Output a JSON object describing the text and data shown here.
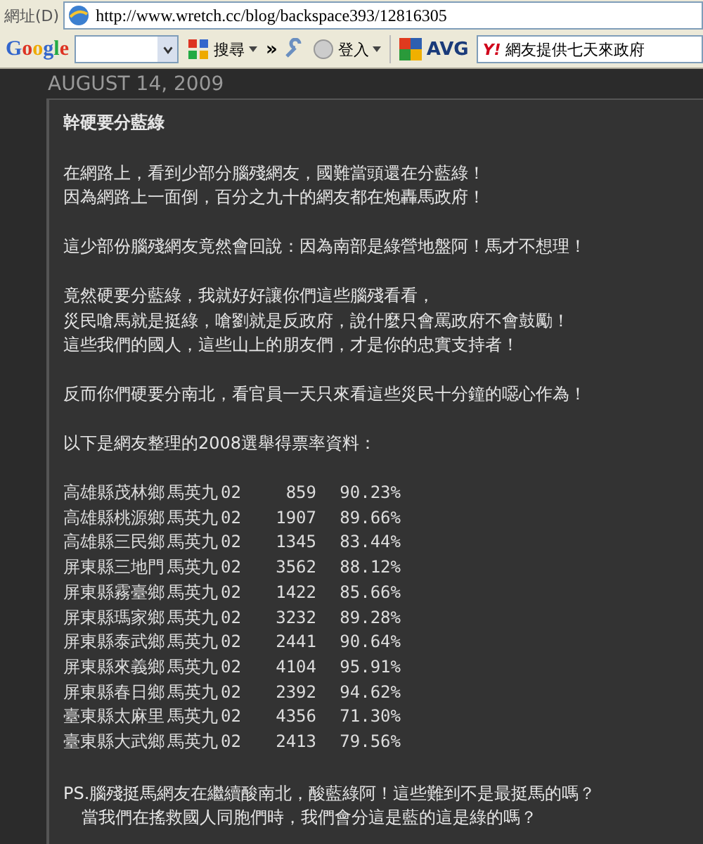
{
  "address_bar": {
    "label": "網址(D)",
    "url": "http://www.wretch.cc/blog/backspace393/12816305"
  },
  "toolbar": {
    "logo": "Google",
    "search_button": "搜尋",
    "more": "»",
    "sign_in": "登入",
    "avg": "AVG",
    "yahoo_logo": "Y!",
    "yahoo_field": "網友提供七天來政府"
  },
  "post": {
    "date": "AUGUST 14, 2009",
    "title": "幹硬要分藍綠",
    "paragraphs": [
      {
        "lines": [
          "在網路上，看到少部分腦殘網友，國難當頭還在分藍綠！",
          "因為網路上一面倒，百分之九十的網友都在炮轟馬政府！"
        ]
      },
      {
        "lines": [
          "這少部份腦殘網友竟然會回說：因為南部是綠營地盤阿！馬才不想理！"
        ]
      },
      {
        "lines": [
          "竟然硬要分藍綠，我就好好讓你們這些腦殘看看，",
          "災民嗆馬就是挺綠，嗆劉就是反政府，說什麼只會罵政府不會鼓勵！",
          "這些我們的國人，這些山上的朋友們，才是你的忠實支持者！"
        ]
      },
      {
        "lines": [
          "反而你們硬要分南北，看官員一天只來看這些災民十分鐘的噁心作為！"
        ]
      },
      {
        "lines": [
          "以下是網友整理的2008選舉得票率資料："
        ]
      }
    ],
    "table": {
      "rows": [
        {
          "place": "高雄縣茂林鄉",
          "candidate": "馬英九",
          "code": "02",
          "votes": "859",
          "percent": "90.23%"
        },
        {
          "place": "高雄縣桃源鄉",
          "candidate": "馬英九",
          "code": "02",
          "votes": "1907",
          "percent": "89.66%"
        },
        {
          "place": "高雄縣三民鄉",
          "candidate": "馬英九",
          "code": "02",
          "votes": "1345",
          "percent": "83.44%"
        },
        {
          "place": "屏東縣三地門",
          "candidate": "馬英九",
          "code": "02",
          "votes": "3562",
          "percent": "88.12%"
        },
        {
          "place": "屏東縣霧臺鄉",
          "candidate": "馬英九",
          "code": "02",
          "votes": "1422",
          "percent": "85.66%"
        },
        {
          "place": "屏東縣瑪家鄉",
          "candidate": "馬英九",
          "code": "02",
          "votes": "3232",
          "percent": "89.28%"
        },
        {
          "place": "屏東縣泰武鄉",
          "candidate": "馬英九",
          "code": "02",
          "votes": "2441",
          "percent": "90.64%"
        },
        {
          "place": "屏東縣來義鄉",
          "candidate": "馬英九",
          "code": "02",
          "votes": "4104",
          "percent": "95.91%"
        },
        {
          "place": "屏東縣春日鄉",
          "candidate": "馬英九",
          "code": "02",
          "votes": "2392",
          "percent": "94.62%"
        },
        {
          "place": "臺東縣太麻里",
          "candidate": "馬英九",
          "code": "02",
          "votes": "4356",
          "percent": "71.30%"
        },
        {
          "place": "臺東縣大武鄉",
          "candidate": "馬英九",
          "code": "02",
          "votes": "2413",
          "percent": "79.56%"
        }
      ]
    },
    "postscript": {
      "lines": [
        "PS.腦殘挺馬網友在繼續酸南北，酸藍綠阿！這些難到不是最挺馬的嗎？",
        "當我們在搖救國人同胞們時，我們會分這是藍的這是綠的嗎？"
      ]
    }
  }
}
